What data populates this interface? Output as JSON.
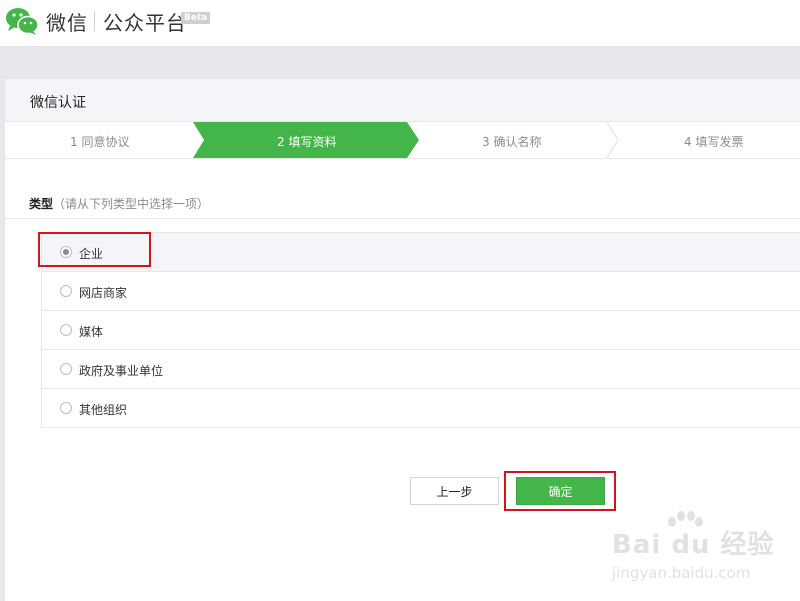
{
  "header": {
    "app_name": "微信",
    "product_name": "公众平台",
    "badge": "Beta",
    "logo_icon": "wechat-logo-icon",
    "brand_color": "#44b549"
  },
  "panel": {
    "title": "微信认证"
  },
  "steps": [
    {
      "label": "1 同意协议",
      "state": "done"
    },
    {
      "label": "2 填写资料",
      "state": "active"
    },
    {
      "label": "3 确认名称",
      "state": "pending"
    },
    {
      "label": "4 填写发票",
      "state": "pending"
    }
  ],
  "type_section": {
    "title": "类型",
    "hint": "（请从下列类型中选择一项）",
    "options": [
      {
        "label": "企业",
        "selected": true
      },
      {
        "label": "网店商家",
        "selected": false
      },
      {
        "label": "媒体",
        "selected": false
      },
      {
        "label": "政府及事业单位",
        "selected": false
      },
      {
        "label": "其他组织",
        "selected": false
      }
    ]
  },
  "buttons": {
    "prev": "上一步",
    "confirm": "确定"
  },
  "annotation_color": "#d0151b",
  "watermark": {
    "logo_text": "Bai du 经验",
    "url": "jingyan.baidu.com"
  }
}
